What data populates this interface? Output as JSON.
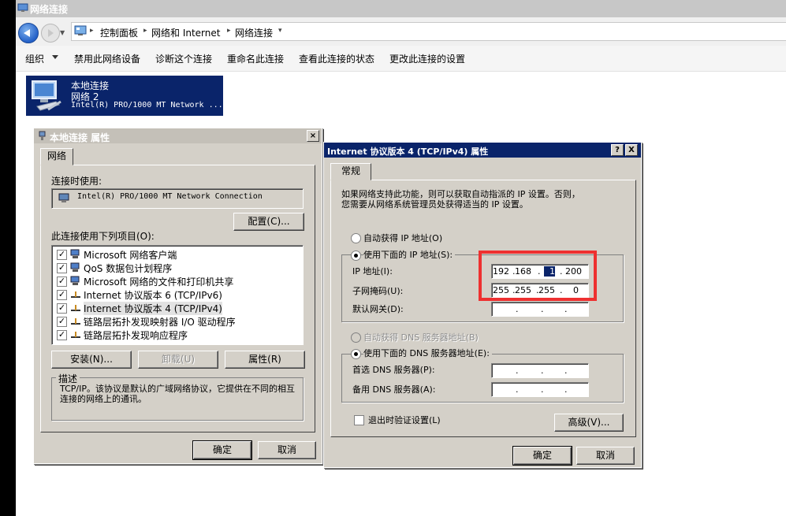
{
  "window": {
    "title": "网络连接"
  },
  "breadcrumb": [
    "控制面板",
    "网络和 Internet",
    "网络连接"
  ],
  "toolbar": {
    "organize": "组织",
    "items": [
      "禁用此网络设备",
      "诊断这个连接",
      "重命名此连接",
      "查看此连接的状态",
      "更改此连接的设置"
    ]
  },
  "connection": {
    "name": "本地连接",
    "network": "网络  2",
    "adapter": "Intel(R) PRO/1000 MT Network ..."
  },
  "props_dialog": {
    "title": "本地连接 属性",
    "tab": "网络",
    "connect_using_label": "连接时使用:",
    "adapter": "Intel(R) PRO/1000 MT Network Connection",
    "configure": "配置(C)...",
    "items_label": "此连接使用下列项目(O):",
    "components": [
      {
        "label": "Microsoft 网络客户端",
        "checked": true
      },
      {
        "label": "QoS 数据包计划程序",
        "checked": true
      },
      {
        "label": "Microsoft 网络的文件和打印机共享",
        "checked": true
      },
      {
        "label": "Internet 协议版本 6 (TCP/IPv6)",
        "checked": true
      },
      {
        "label": "Internet 协议版本 4 (TCP/IPv4)",
        "checked": true
      },
      {
        "label": "链路层拓扑发现映射器 I/O 驱动程序",
        "checked": true
      },
      {
        "label": "链路层拓扑发现响应程序",
        "checked": true
      }
    ],
    "install": "安装(N)...",
    "uninstall": "卸载(U)",
    "properties": "属性(R)",
    "description_title": "描述",
    "description": "TCP/IP。该协议是默认的广域网络协议，它提供在不同的相互连接的网络上的通讯。",
    "ok": "确定",
    "cancel": "取消"
  },
  "ipv4_dialog": {
    "title": "Internet 协议版本 4 (TCP/IPv4) 属性",
    "help_btn": "?",
    "close_btn": "X",
    "tab": "常规",
    "intro_line1": "如果网络支持此功能，则可以获取自动指派的 IP 设置。否则，",
    "intro_line2": "您需要从网络系统管理员处获得适当的 IP 设置。",
    "auto_ip": "自动获得 IP 地址(O)",
    "manual_ip": "使用下面的 IP 地址(S):",
    "ip_label": "IP 地址(I):",
    "mask_label": "子网掩码(U):",
    "gateway_label": "默认网关(D):",
    "ip": [
      "192",
      "168",
      "1",
      "200"
    ],
    "mask": [
      "255",
      "255",
      "255",
      "0"
    ],
    "auto_dns": "自动获得 DNS 服务器地址(B)",
    "manual_dns": "使用下面的 DNS 服务器地址(E):",
    "pref_dns": "首选 DNS 服务器(P):",
    "alt_dns": "备用 DNS 服务器(A):",
    "validate": "退出时验证设置(L)",
    "advanced": "高级(V)...",
    "ok": "确定",
    "cancel": "取消"
  }
}
